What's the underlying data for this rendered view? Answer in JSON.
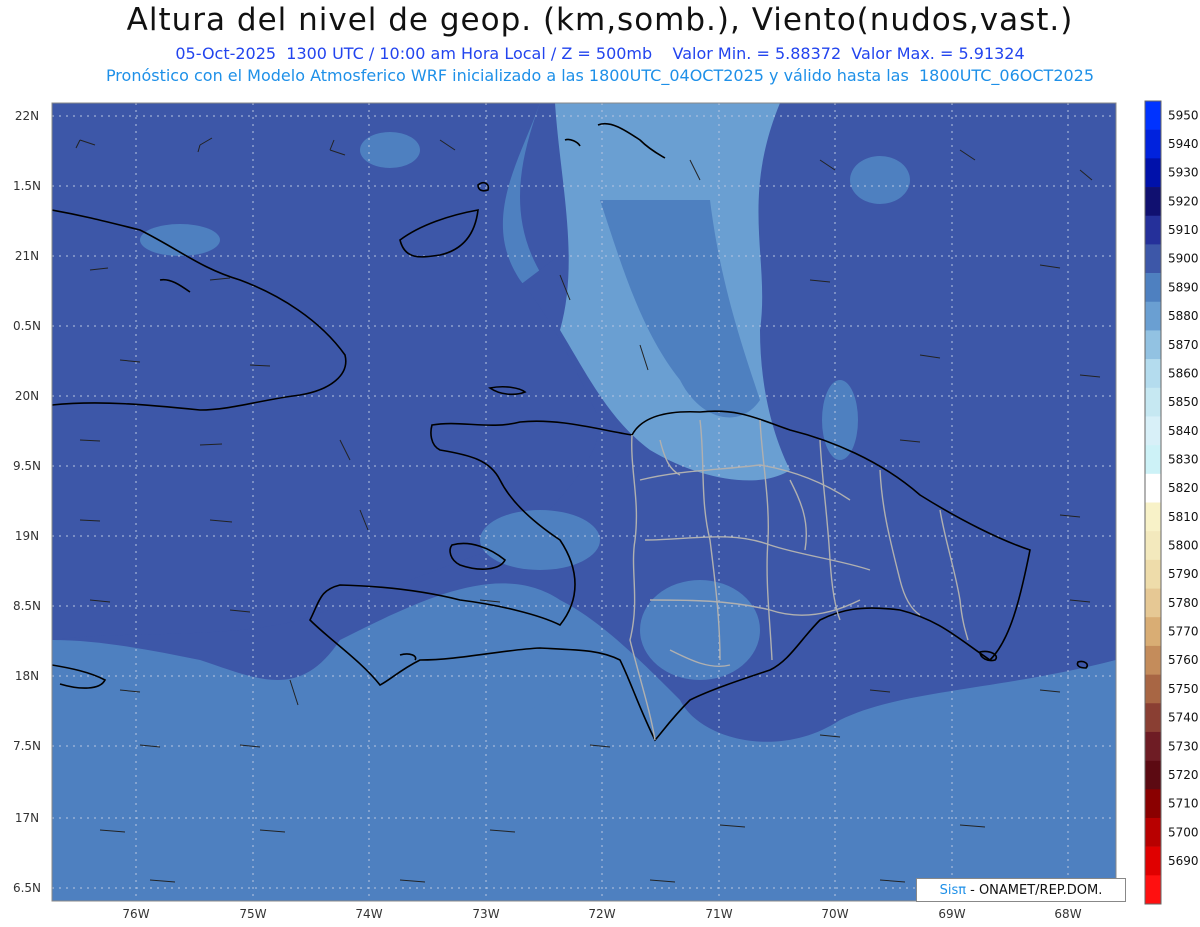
{
  "title": "Altura del nivel de geop. (km,somb.), Viento(nudos,vast.)",
  "subtitle_line1": "05-Oct-2025  1300 UTC / 10:00 am Hora Local / Z = 500mb    Valor Min. = 5.88372  Valor Max. = 5.91324",
  "subtitle_line2": "Pronóstico con el Modelo Atmosferico WRF inicializado a las 1800UTC_04OCT2025 y válido hasta las  1800UTC_06OCT2025",
  "lat_labels": [
    "22N",
    "1.5N",
    "21N",
    "0.5N",
    "20N",
    "9.5N",
    "19N",
    "8.5N",
    "18N",
    "7.5N",
    "17N",
    "6.5N"
  ],
  "lon_labels": [
    "76W",
    "75W",
    "74W",
    "73W",
    "72W",
    "71W",
    "70W",
    "69W",
    "68W"
  ],
  "colorbar": [
    {
      "label": "5950",
      "color": "#0033ff"
    },
    {
      "label": "5940",
      "color": "#0022dd"
    },
    {
      "label": "5930",
      "color": "#0011aa"
    },
    {
      "label": "5920",
      "color": "#101070"
    },
    {
      "label": "5910",
      "color": "#25309a"
    },
    {
      "label": "5900",
      "color": "#3d57a8"
    },
    {
      "label": "5890",
      "color": "#4e80c0"
    },
    {
      "label": "5880",
      "color": "#6a9fd2"
    },
    {
      "label": "5870",
      "color": "#92c2e2"
    },
    {
      "label": "5860",
      "color": "#b4dcee"
    },
    {
      "label": "5850",
      "color": "#c6e8f2"
    },
    {
      "label": "5840",
      "color": "#d8f0f8"
    },
    {
      "label": "5830",
      "color": "#cdf2f7"
    },
    {
      "label": "5820",
      "color": "#ffffff"
    },
    {
      "label": "5810",
      "color": "#f8f2c8"
    },
    {
      "label": "5800",
      "color": "#f3e9bd"
    },
    {
      "label": "5790",
      "color": "#eedcaa"
    },
    {
      "label": "5780",
      "color": "#e6c894"
    },
    {
      "label": "5770",
      "color": "#d9ad74"
    },
    {
      "label": "5760",
      "color": "#c48c5b"
    },
    {
      "label": "5750",
      "color": "#a86644"
    },
    {
      "label": "5740",
      "color": "#8a3f33"
    },
    {
      "label": "5730",
      "color": "#6e1c24"
    },
    {
      "label": "5720",
      "color": "#5c0a12"
    },
    {
      "label": "5710",
      "color": "#8a0000"
    },
    {
      "label": "5700",
      "color": "#b80000"
    },
    {
      "label": "5690",
      "color": "#e00000"
    },
    {
      "label": "",
      "color": "#ff1010"
    }
  ],
  "credit": {
    "brand": "Sisπ",
    "text": "- ONAMET/REP.DOM."
  },
  "colors": {
    "field_dark": "#3d57a8",
    "field_mid": "#4e80c0",
    "field_light": "#6a9fd2",
    "coast": "#000000",
    "borders": "#b0b0b0"
  }
}
